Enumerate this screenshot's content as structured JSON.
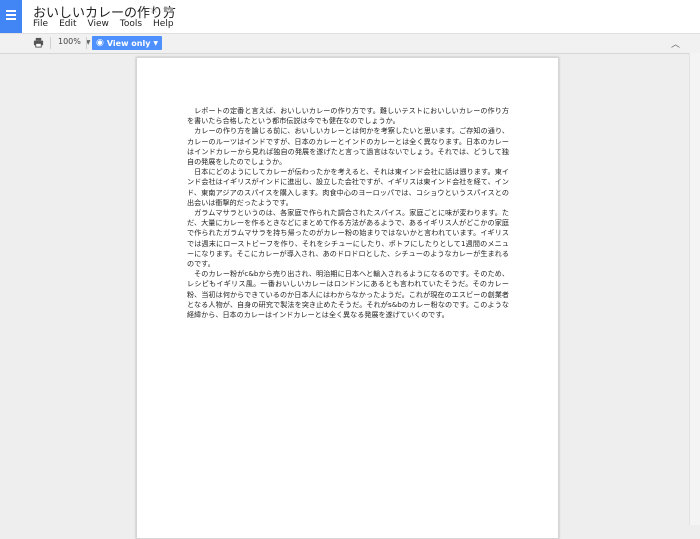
{
  "header": {
    "title": "おいしいカレーの作り方",
    "menu": [
      "File",
      "Edit",
      "View",
      "Tools",
      "Help"
    ]
  },
  "toolbar": {
    "zoom": "100%",
    "view_mode": "View only",
    "accent_color": "#4d90fe"
  },
  "document": {
    "paragraphs": [
      "レポートの定番と言えば、おいしいカレーの作り方です。難しいテストにおいしいカレーの作り方を書いたら合格したという都市伝説は今でも健在なのでしょうか。",
      "カレーの作り方を論じる前に、おいしいカレーとは何かを考察したいと思います。ご存知の通り、カレーのルーツはインドですが、日本のカレーとインドのカレーとは全く異なります。日本のカレーはインドカレーから見れば独自の発展を遂げたと言って過言はないでしょう。それでは、どうして独自の発展をしたのでしょうか。",
      "日本にどのようにしてカレーが伝わったかを考えると、それは東インド会社に話は遡ります。東インド会社はイギリスがインドに進出し、設立した会社ですが、イギリスは東インド会社を経て、インド、東南アジアのスパイスを購入します。肉食中心のヨーロッパでは、コショウというスパイスとの出会いは衝撃的だったようです。",
      "ガラムマサラというのは、各家庭で作られた調合されたスパイス。家庭ごとに味が変わります。ただ、大量にカレーを作るときなどにまとめて作る方法があるようで、あるイギリス人がどこかの家庭で作られたガラムマサラを持ち帰ったのがカレー粉の始まりではないかと言われています。イギリスでは週末にローストビーフを作り、それをシチューにしたり、ポトフにしたりとして1週間のメニューになります。そこにカレーが導入され、あのドロドロとした、シチューのようなカレーが生まれるのです。",
      "そのカレー粉がc&bから売り出され、明治期に日本へと輸入されるようになるのです。そのため、レシピもイギリス風。一番おいしいカレーはロンドンにあるとも言われていたそうだ。そのカレー粉、当初は何からできているのか日本人にはわからなかったようだ。これが現在のエスビーの創業者となる人物が、自身の研究で製法を突き止めたそうだ。それがs&bのカレー粉なのです。このような経緯から、日本のカレーはインドカレーとは全く異なる発展を遂げていくのです。"
    ]
  }
}
